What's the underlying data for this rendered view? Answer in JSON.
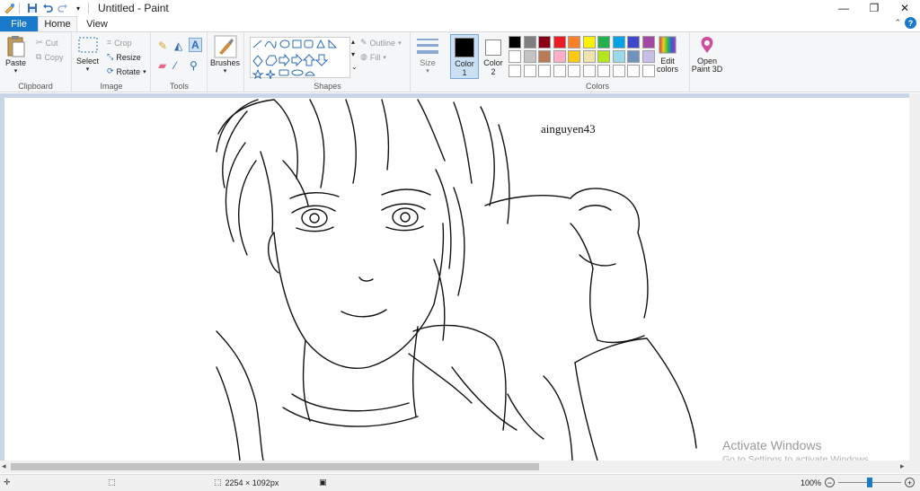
{
  "window": {
    "title": "Untitled - Paint",
    "controls": {
      "minimize": "—",
      "restore": "❐",
      "close": "✕"
    }
  },
  "tabs": {
    "file": "File",
    "home": "Home",
    "view": "View"
  },
  "ribbon": {
    "clipboard": {
      "label": "Clipboard",
      "paste": "Paste",
      "cut": "Cut",
      "copy": "Copy"
    },
    "image": {
      "label": "Image",
      "select": "Select",
      "crop": "Crop",
      "resize": "Resize",
      "rotate": "Rotate"
    },
    "tools": {
      "label": "Tools"
    },
    "brushes": {
      "label": "Brushes"
    },
    "shapes": {
      "label": "Shapes",
      "outline": "Outline",
      "fill": "Fill"
    },
    "size": {
      "label": "Size"
    },
    "color1": {
      "label": "Color",
      "index": "1",
      "value": "#000000"
    },
    "color2": {
      "label": "Color",
      "index": "2",
      "value": "#ffffff"
    },
    "colors": {
      "label": "Colors",
      "row1": [
        "#000000",
        "#7f7f7f",
        "#880015",
        "#ed1c24",
        "#ff7f27",
        "#fff200",
        "#22b14c",
        "#00a2e8",
        "#3f48cc",
        "#a349a4"
      ],
      "row2": [
        "#ffffff",
        "#c3c3c3",
        "#b97a57",
        "#ffaec9",
        "#ffc90e",
        "#efe4b0",
        "#b5e61d",
        "#99d9ea",
        "#7092be",
        "#c8bfe7"
      ],
      "row3": [
        "#ffffff",
        "#ffffff",
        "#ffffff",
        "#ffffff",
        "#ffffff",
        "#ffffff",
        "#ffffff",
        "#ffffff",
        "#ffffff",
        "#ffffff"
      ]
    },
    "edit_colors": {
      "line1": "Edit",
      "line2": "colors"
    },
    "paint3d": {
      "line1": "Open",
      "line2": "Paint 3D"
    }
  },
  "canvas": {
    "signature": "ainguyen43",
    "watermark_title": "Activate Windows",
    "watermark_sub": "Go to Settings to activate Windows."
  },
  "status": {
    "dimensions": "2254 × 1092px",
    "zoom": "100%",
    "zoom_level": 0.5
  }
}
